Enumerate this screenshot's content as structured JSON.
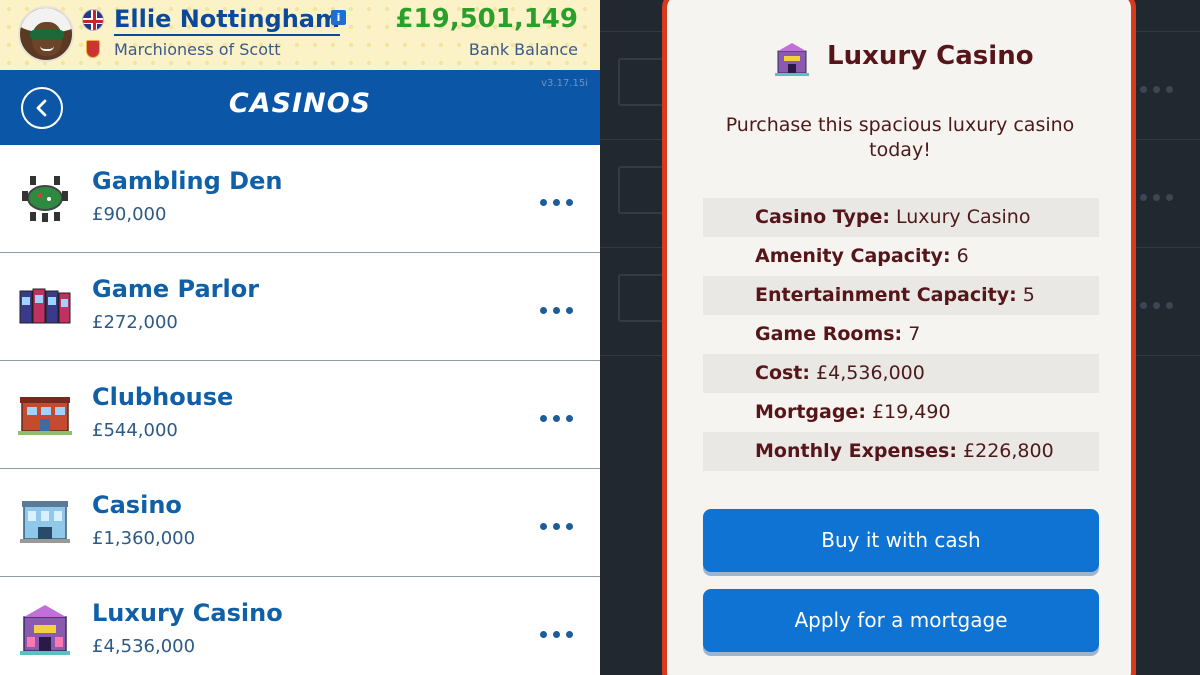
{
  "header": {
    "player_name": "Ellie Nottingham",
    "player_title": "Marchioness of Scott",
    "balance": "£19,501,149",
    "balance_label": "Bank Balance",
    "info_icon": "i"
  },
  "titlebar": {
    "title": "CASINOS",
    "version": "v3.17.15i"
  },
  "list": {
    "items": [
      {
        "name": "Gambling Den",
        "price": "£90,000",
        "icon": "gambling-den-icon"
      },
      {
        "name": "Game Parlor",
        "price": "£272,000",
        "icon": "game-parlor-icon"
      },
      {
        "name": "Clubhouse",
        "price": "£544,000",
        "icon": "clubhouse-icon"
      },
      {
        "name": "Casino",
        "price": "£1,360,000",
        "icon": "casino-icon"
      },
      {
        "name": "Luxury Casino",
        "price": "£4,536,000",
        "icon": "luxury-casino-icon"
      }
    ]
  },
  "modal": {
    "title": "Luxury Casino",
    "description": "Purchase this spacious luxury casino today!",
    "details": [
      {
        "label": "Casino Type:",
        "value": "Luxury Casino"
      },
      {
        "label": "Amenity Capacity:",
        "value": "6"
      },
      {
        "label": "Entertainment Capacity:",
        "value": "5"
      },
      {
        "label": "Game Rooms:",
        "value": "7"
      },
      {
        "label": "Cost:",
        "value": "£4,536,000"
      },
      {
        "label": "Mortgage:",
        "value": "£19,490"
      },
      {
        "label": "Monthly Expenses:",
        "value": "£226,800"
      }
    ],
    "buy_cash_label": "Buy it with cash",
    "mortgage_label": "Apply for a mortgage"
  },
  "colors": {
    "brand_blue": "#0b56a6",
    "balance_green": "#2aa02a",
    "modal_border": "#d83a1e",
    "button_blue": "#0e73d2"
  }
}
